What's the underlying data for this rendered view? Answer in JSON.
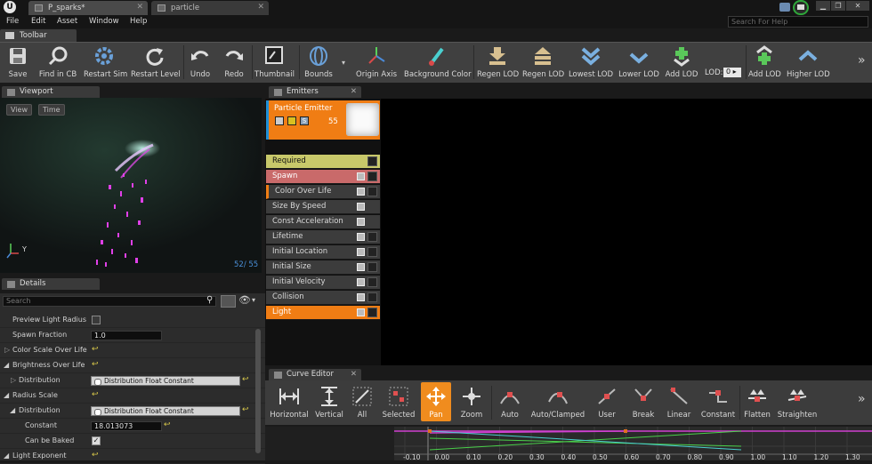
{
  "titlebar": {
    "logo": "U",
    "tabs": [
      {
        "label": "P_sparks*"
      },
      {
        "label": "particle"
      }
    ]
  },
  "menu": [
    "File",
    "Edit",
    "Asset",
    "Window",
    "Help"
  ],
  "search_help": {
    "placeholder": "Search For Help"
  },
  "toolbar": {
    "tab_label": "Toolbar",
    "buttons": [
      "Save",
      "Find in CB",
      "Restart Sim",
      "Restart Level",
      "Undo",
      "Redo",
      "Thumbnail",
      "Bounds",
      "Origin Axis",
      "Background Color",
      "Regen LOD",
      "Regen LOD",
      "Lowest LOD",
      "Lower LOD",
      "Add LOD",
      "LOD:",
      "Add LOD",
      "Higher LOD"
    ],
    "lod_value": "0"
  },
  "viewport": {
    "tab_label": "Viewport",
    "view_btn": "View",
    "time_btn": "Time",
    "axis_y": "Y",
    "counter": "52/  55"
  },
  "details": {
    "tab_label": "Details",
    "search_placeholder": "Search",
    "rows": [
      {
        "label": "Preview Light Radius"
      },
      {
        "label": "Spawn Fraction",
        "value": "1.0"
      },
      {
        "label": "Color Scale Over Life"
      },
      {
        "label": "Brightness Over Life"
      },
      {
        "label": "Distribution",
        "value": "Distribution Float Constant"
      },
      {
        "label": "Radius Scale"
      },
      {
        "label": "Distribution",
        "value": "Distribution Float Constant"
      },
      {
        "label": "Constant",
        "value": "18.013073"
      },
      {
        "label": "Can be Baked"
      },
      {
        "label": "Light Exponent"
      }
    ]
  },
  "emitters": {
    "tab_label": "Emitters",
    "emitter_title": "Particle Emitter",
    "emitter_count": "55",
    "modules": [
      "Required",
      "Spawn",
      "Color Over Life",
      "Size By Speed",
      "Const Acceleration",
      "Lifetime",
      "Initial Location",
      "Initial Size",
      "Initial Velocity",
      "Collision",
      "Light"
    ]
  },
  "curve_editor": {
    "tab_label": "Curve Editor",
    "buttons": [
      "Horizontal",
      "Vertical",
      "All",
      "Selected",
      "Pan",
      "Zoom",
      "Auto",
      "Auto/Clamped",
      "User",
      "Break",
      "Linear",
      "Constant",
      "Flatten",
      "Straighten"
    ],
    "axis_labels": [
      "-0.10",
      "0.00",
      "0.10",
      "0.20",
      "0.30",
      "0.40",
      "0.50",
      "0.60",
      "0.70",
      "0.80",
      "0.90",
      "1.00",
      "1.10",
      "1.20",
      "1.30"
    ]
  },
  "colors": {
    "accent": "#f07d14",
    "spawn": "#c96a6a",
    "required": "#c8c86a",
    "blue_marker": "#1e8fd8"
  }
}
